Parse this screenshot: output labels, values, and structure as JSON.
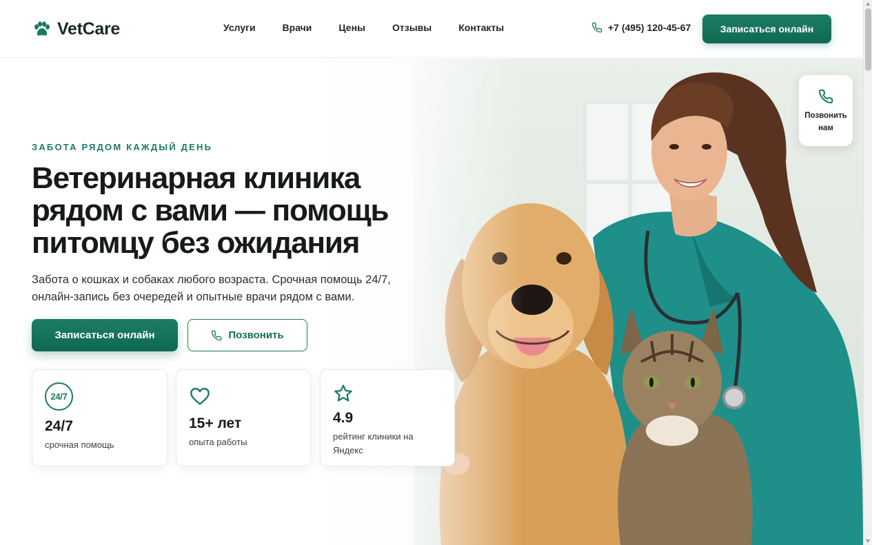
{
  "header": {
    "logo_text": "VetCare",
    "nav": [
      "Услуги",
      "Врачи",
      "Цены",
      "Отзывы",
      "Контакты"
    ],
    "phone": "+7 (495) 120-45-67",
    "cta_label": "Записаться онлайн"
  },
  "hero": {
    "eyebrow": "Забота рядом каждый день",
    "title": "Ветеринарная клиника рядом с вами — помощь питомцу без ожидания",
    "subtitle": "Забота о кошках и собаках любого возраста. Срочная помощь 24/7, онлайн-запись без очередей и опытные врачи рядом с вами.",
    "primary_button": "Записаться онлайн",
    "secondary_button": "Позвонить"
  },
  "stats": [
    {
      "badge": "24/7",
      "value": "24/7",
      "label": "срочная помощь",
      "icon": "clock-badge-icon"
    },
    {
      "value": "15+ лет",
      "label": "опыта работы",
      "icon": "heart-icon"
    },
    {
      "value": "4.9",
      "label": "рейтинг клиники на Яндекс",
      "icon": "star-icon"
    }
  ],
  "call_widget": {
    "label": "Позвонить нам",
    "icon": "phone-icon"
  },
  "colors": {
    "accent": "#1b7a62",
    "accent_dark": "#0f6853",
    "text": "#161b18"
  }
}
